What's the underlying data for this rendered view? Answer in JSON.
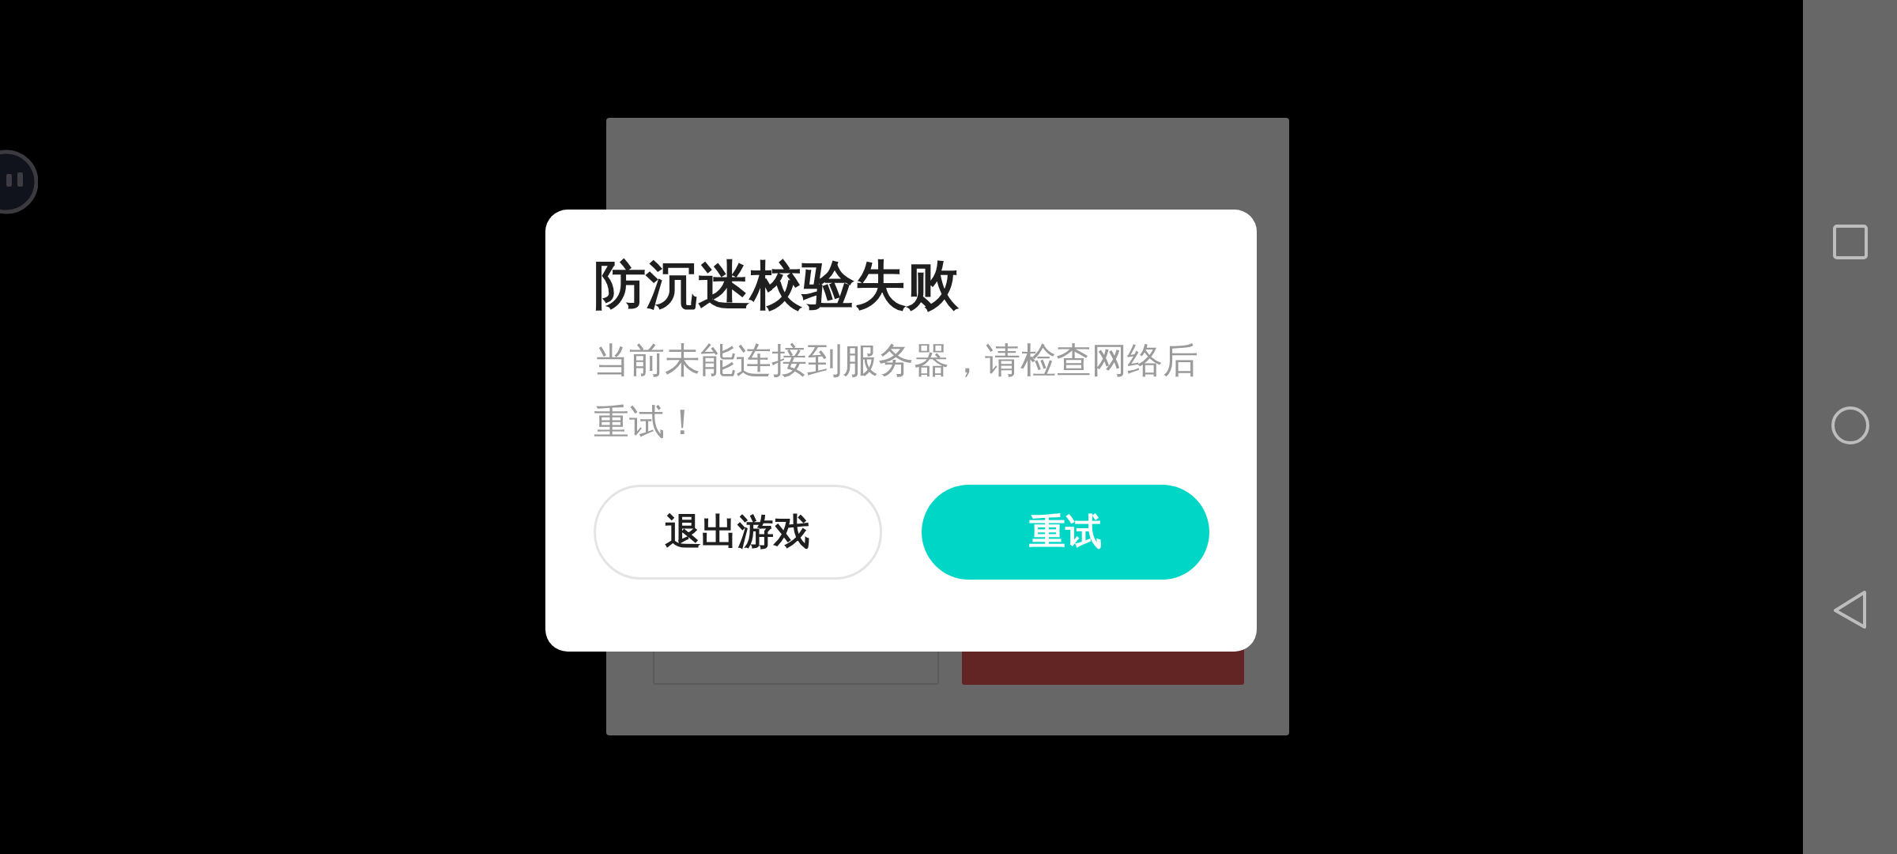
{
  "dialog": {
    "title": "防沉迷校验失败",
    "message": "当前未能连接到服务器，请检查网络后重试！",
    "buttons": [
      {
        "label": "退出游戏",
        "kind": "secondary"
      },
      {
        "label": "重试",
        "kind": "primary"
      }
    ]
  }
}
